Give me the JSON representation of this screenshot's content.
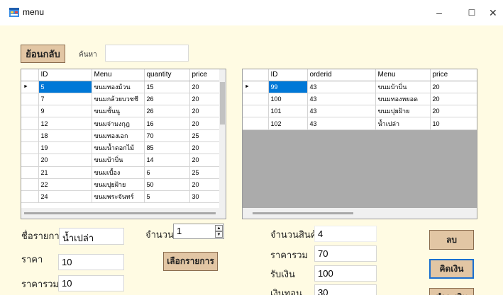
{
  "window": {
    "title": "menu",
    "minimize": "–",
    "maximize": "☐",
    "close": "✕"
  },
  "toolbar": {
    "back_label": "ย้อนกลับ",
    "search_label": "ค้นหา",
    "search_value": ""
  },
  "menu_grid": {
    "columns": [
      "ID",
      "Menu",
      "quantity",
      "price"
    ],
    "rows": [
      [
        "5",
        "ขนมทองม้วน",
        "15",
        "20"
      ],
      [
        "7",
        "ขนมกล้วยบวชชี",
        "26",
        "20"
      ],
      [
        "9",
        "ขนมชั้นนู",
        "26",
        "20"
      ],
      [
        "12",
        "ขนมจ่ามงกุฎ",
        "16",
        "20"
      ],
      [
        "18",
        "ขนมทองเอก",
        "70",
        "25"
      ],
      [
        "19",
        "ขนมน้ำดอกไม้",
        "85",
        "20"
      ],
      [
        "20",
        "ขนมบ้าบิ่น",
        "14",
        "20"
      ],
      [
        "21",
        "ขนมเบื้อง",
        "6",
        "25"
      ],
      [
        "22",
        "ขนมปุยฝ้าย",
        "50",
        "20"
      ],
      [
        "24",
        "ขนมพระจันทร์",
        "5",
        "30"
      ]
    ]
  },
  "order_grid": {
    "columns": [
      "ID",
      "orderid",
      "Menu",
      "price"
    ],
    "rows": [
      [
        "99",
        "43",
        "ขนมบ้าบิ่น",
        "20"
      ],
      [
        "100",
        "43",
        "ขนมทองหยอด",
        "20"
      ],
      [
        "101",
        "43",
        "ขนมปุยฝ้าย",
        "20"
      ],
      [
        "102",
        "43",
        "น้ำเปล่า",
        "10"
      ]
    ]
  },
  "item_form": {
    "name_label": "ชื่อรายการ",
    "name_value": "น้ำเปล่า",
    "price_label": "ราคา",
    "price_value": "10",
    "total_label": "ราคารวม",
    "total_value": "10",
    "qty_label": "จำนวน",
    "qty_value": "1",
    "select_button": "เลือกรายการ"
  },
  "summary": {
    "count_label": "จำนวนสินค้า",
    "count_value": "4",
    "total_label": "ราคารวม",
    "total_value": "70",
    "received_label": "รับเงิน",
    "received_value": "100",
    "change_label": "เงินทอน",
    "change_value": "30"
  },
  "actions": {
    "delete_label": "ลบ",
    "calc_label": "คิดเงิน",
    "bottom_label": "ชำระเงิน"
  },
  "colors": {
    "background": "#fffbe3",
    "button": "#e2c6a4",
    "selection": "#0078d7"
  }
}
